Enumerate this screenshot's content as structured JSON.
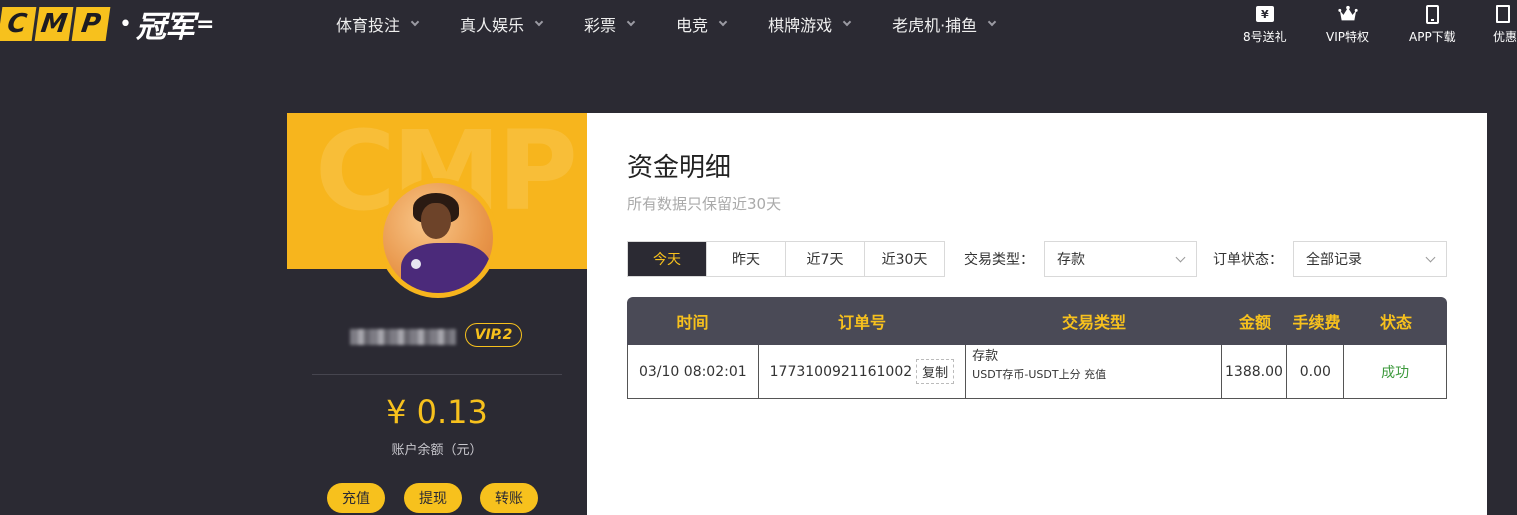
{
  "brand": {
    "letters": [
      "C",
      "M",
      "P"
    ],
    "dot": "•",
    "cn_name": "冠军",
    "accent_color": "#f7c11d"
  },
  "nav": {
    "items": [
      {
        "label": "体育投注"
      },
      {
        "label": "真人娱乐"
      },
      {
        "label": "彩票"
      },
      {
        "label": "电竞"
      },
      {
        "label": "棋牌游戏"
      },
      {
        "label": "老虎机·捕鱼"
      }
    ]
  },
  "quick_links": {
    "gift_glyph": "¥",
    "gift_label": "8号送礼",
    "vip_label": "VIP特权",
    "app_label": "APP下载",
    "promo_label": "优惠"
  },
  "profile": {
    "banner_watermark": "CMP",
    "vip_level": "VIP.2",
    "balance": "¥ 0.13",
    "balance_label": "账户余额（元）",
    "buttons": {
      "deposit": "充值",
      "withdraw": "提现",
      "transfer": "转账"
    }
  },
  "main": {
    "title": "资金明细",
    "subtitle": "所有数据只保留近30天",
    "ranges": [
      {
        "label": "今天",
        "active": true
      },
      {
        "label": "昨天",
        "active": false
      },
      {
        "label": "近7天",
        "active": false
      },
      {
        "label": "近30天",
        "active": false
      }
    ],
    "filters": {
      "type_label": "交易类型：",
      "type_value": "存款",
      "status_label": "订单状态：",
      "status_value": "全部记录"
    },
    "table": {
      "headers": [
        "时间",
        "订单号",
        "交易类型",
        "金额",
        "手续费",
        "状态"
      ],
      "rows": [
        {
          "time": "03/10 08:02:01",
          "order_no": "1773100921161002",
          "copy_label": "复制",
          "type_main": "存款",
          "type_sub": "USDT存币-USDT上分 充值",
          "amount": "1388.00",
          "fee": "0.00",
          "status": "成功"
        }
      ]
    }
  }
}
